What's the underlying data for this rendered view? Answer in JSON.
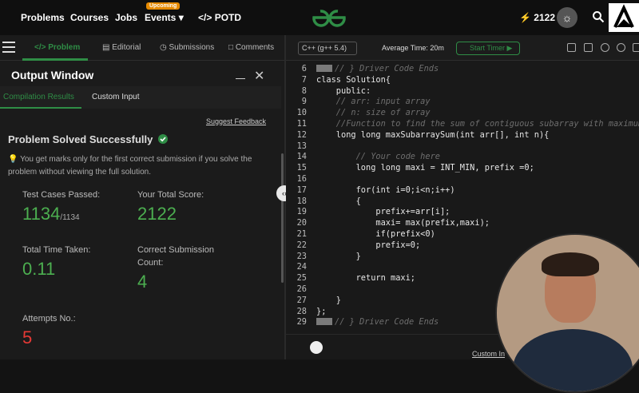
{
  "nav": {
    "items": [
      "Problems",
      "Courses",
      "Jobs",
      "Events",
      "POTD"
    ],
    "events_badge": "Upcoming",
    "potd_prefix": "</>",
    "streak": "2122"
  },
  "tabs": [
    "Problem",
    "Editorial",
    "Submissions",
    "Comments"
  ],
  "output_window": {
    "title": "Output Window",
    "subtabs": [
      "Compilation Results",
      "Custom Input"
    ],
    "suggest_feedback": "Suggest Feedback",
    "status": "Problem Solved Successfully",
    "note": "You get marks only for the first correct submission if you solve the problem without viewing the full solution.",
    "stats": {
      "test_cases_label": "Test Cases Passed:",
      "test_cases_value": "1134",
      "test_cases_total": "/1134",
      "score_label": "Your Total Score:",
      "score_value": "2122",
      "time_label": "Total Time Taken:",
      "time_value": "0.11",
      "correct_label": "Correct Submission Count:",
      "correct_value": "4",
      "attempts_label": "Attempts No.:",
      "attempts_value": "5"
    }
  },
  "editor": {
    "language": "C++ (g++ 5.4)",
    "average_time": "Average Time: 20m",
    "start_timer": "Start Timer",
    "custom_input": "Custom In",
    "lines": [
      {
        "n": "6",
        "text": "// } Driver Code Ends",
        "type": "fold"
      },
      {
        "n": "7",
        "text": "class Solution{",
        "type": "code"
      },
      {
        "n": "8",
        "text": "    public:",
        "type": "code"
      },
      {
        "n": "9",
        "text": "    // arr: input array",
        "type": "comment"
      },
      {
        "n": "10",
        "text": "    // n: size of array",
        "type": "comment"
      },
      {
        "n": "11",
        "text": "    //Function to find the sum of contiguous subarray with maximum",
        "type": "comment"
      },
      {
        "n": "12",
        "text": "    long long maxSubarraySum(int arr[], int n){",
        "type": "code"
      },
      {
        "n": "13",
        "text": "",
        "type": "code"
      },
      {
        "n": "14",
        "text": "        // Your code here",
        "type": "comment"
      },
      {
        "n": "15",
        "text": "        long long maxi = INT_MIN, prefix =0;",
        "type": "code"
      },
      {
        "n": "16",
        "text": "",
        "type": "code"
      },
      {
        "n": "17",
        "text": "        for(int i=0;i<n;i++)",
        "type": "code"
      },
      {
        "n": "18",
        "text": "        {",
        "type": "code"
      },
      {
        "n": "19",
        "text": "            prefix+=arr[i];",
        "type": "code"
      },
      {
        "n": "20",
        "text": "            maxi= max(prefix,maxi);",
        "type": "code"
      },
      {
        "n": "21",
        "text": "            if(prefix<0)",
        "type": "code"
      },
      {
        "n": "22",
        "text": "            prefix=0;",
        "type": "code"
      },
      {
        "n": "23",
        "text": "        }",
        "type": "code"
      },
      {
        "n": "24",
        "text": "",
        "type": "code"
      },
      {
        "n": "25",
        "text": "        return maxi;",
        "type": "code"
      },
      {
        "n": "26",
        "text": "",
        "type": "code"
      },
      {
        "n": "27",
        "text": "    }",
        "type": "code"
      },
      {
        "n": "28",
        "text": "};",
        "type": "code"
      },
      {
        "n": "29",
        "text": "// } Driver Code Ends",
        "type": "fold"
      }
    ]
  },
  "colors": {
    "accent": "#2f8d46",
    "success": "#4caf50",
    "error": "#e53935"
  }
}
